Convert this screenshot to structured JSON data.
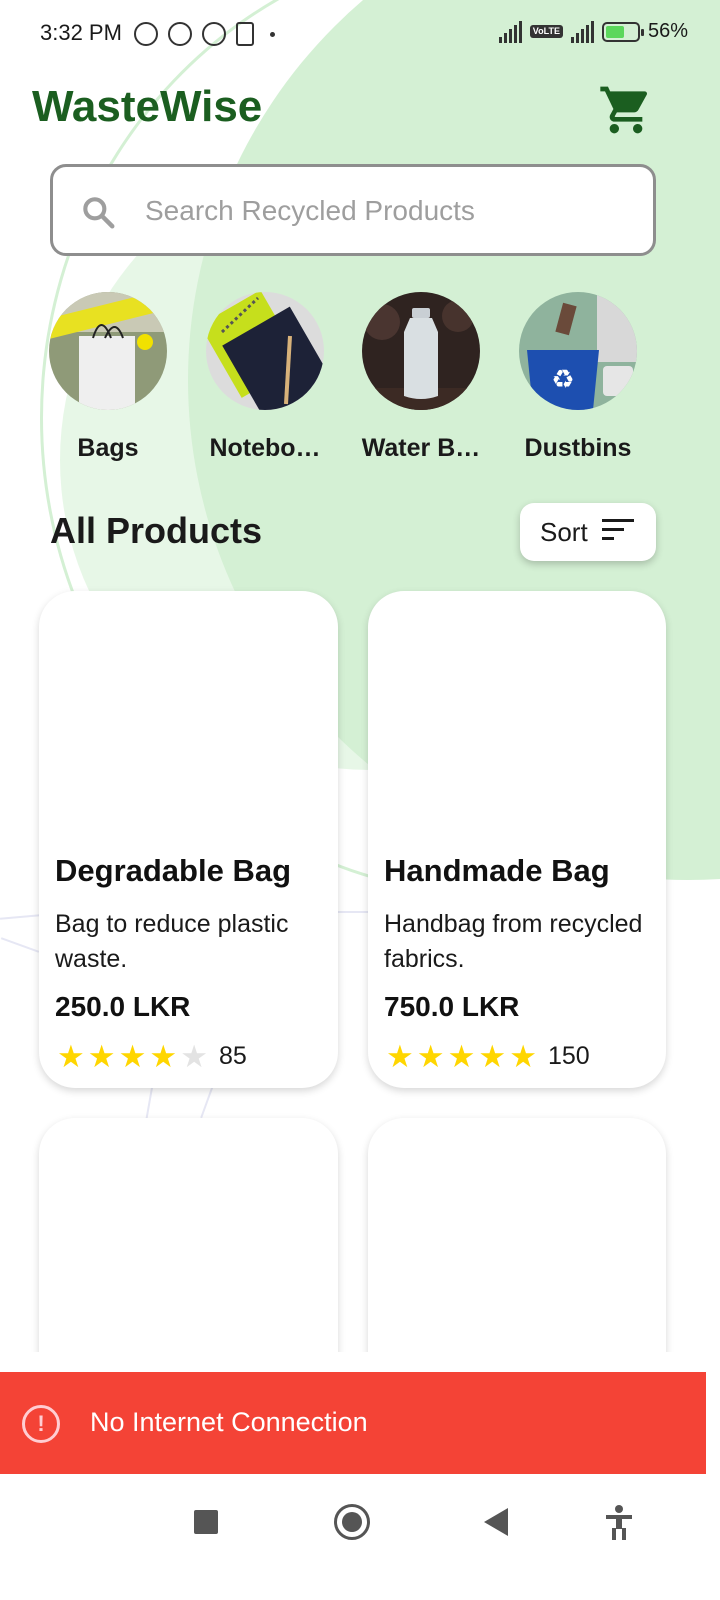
{
  "status_bar": {
    "time": "3:32 PM",
    "battery": "56%",
    "network_badge": "VoLTE"
  },
  "header": {
    "title": "WasteWise",
    "cart_icon": "cart-icon"
  },
  "search": {
    "placeholder": "Search Recycled Products",
    "value": ""
  },
  "categories": [
    {
      "label": "Bags",
      "icon": "bag-photo"
    },
    {
      "label": "Notebo…",
      "icon": "notebook-photo"
    },
    {
      "label": "Water B…",
      "icon": "water-bottle-photo"
    },
    {
      "label": "Dustbins",
      "icon": "dustbin-photo"
    }
  ],
  "section": {
    "title": "All Products",
    "sort_label": "Sort"
  },
  "products": [
    {
      "title": "Degradable Bag",
      "description": "Bag to reduce plastic waste.",
      "price": "250.0 LKR",
      "rating": 4,
      "rating_max": 5,
      "reviews": "85"
    },
    {
      "title": "Handmade Bag",
      "description": "Handbag from recycled fabrics.",
      "price": "750.0 LKR",
      "rating": 5,
      "rating_max": 5,
      "reviews": "150"
    }
  ],
  "snackbar": {
    "message": "No Internet Connection",
    "icon": "alert-circle-icon"
  },
  "colors": {
    "brand_green": "#1b5e20",
    "background_blob": "#d4f0d4",
    "error_red": "#f44336",
    "star_yellow": "#ffd600"
  }
}
